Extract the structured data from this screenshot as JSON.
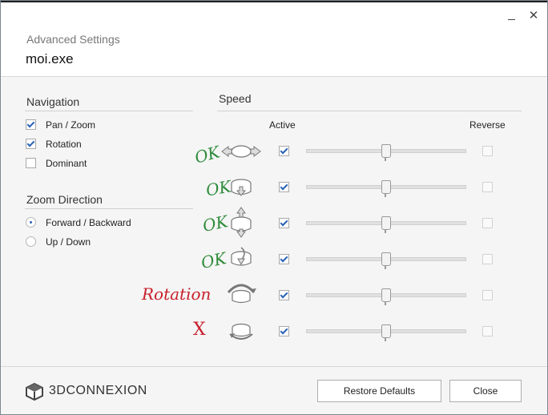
{
  "window": {
    "subtitle": "Advanced Settings",
    "title": "moi.exe",
    "minimize_icon": "minimize-icon",
    "close_glyph": "✕"
  },
  "navigation": {
    "heading": "Navigation",
    "options": [
      {
        "label": "Pan / Zoom",
        "checked": true
      },
      {
        "label": "Rotation",
        "checked": true
      },
      {
        "label": "Dominant",
        "checked": false
      }
    ]
  },
  "zoom_direction": {
    "heading": "Zoom Direction",
    "options": [
      {
        "label": "Forward / Backward",
        "selected": true
      },
      {
        "label": "Up / Down",
        "selected": false
      }
    ]
  },
  "speed": {
    "heading": "Speed",
    "active_label": "Active",
    "reverse_label": "Reverse",
    "rows": [
      {
        "axis": "pan-left-right-icon",
        "annotation": "OK",
        "active": true,
        "reverse": false,
        "value": 0.5
      },
      {
        "axis": "pan-up-down-icon",
        "annotation": "OK",
        "active": true,
        "reverse": false,
        "value": 0.5
      },
      {
        "axis": "zoom-in-out-icon",
        "annotation": "OK",
        "active": true,
        "reverse": false,
        "value": 0.5
      },
      {
        "axis": "tilt-icon",
        "annotation": "OK",
        "active": true,
        "reverse": false,
        "value": 0.5
      },
      {
        "axis": "roll-icon",
        "annotation": "Rotation",
        "active": true,
        "reverse": false,
        "value": 0.5
      },
      {
        "axis": "spin-icon",
        "annotation": "X",
        "active": true,
        "reverse": false,
        "value": 0.5
      }
    ]
  },
  "colors": {
    "ok_green": "#2e8b3a",
    "rotation_red": "#c8202a",
    "accent_blue": "#2a63b8"
  },
  "footer": {
    "brand": "3DCONNEXION",
    "restore_label": "Restore Defaults",
    "close_label": "Close"
  }
}
